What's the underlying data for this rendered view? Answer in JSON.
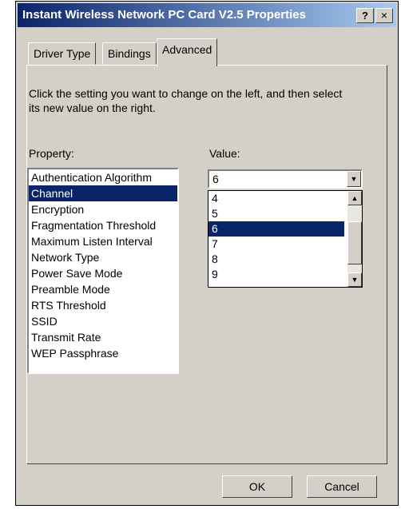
{
  "window": {
    "title": "Instant Wireless Network PC Card V2.5 Properties"
  },
  "titlebar": {
    "help_label": "?",
    "close_label": "×"
  },
  "tabs": [
    {
      "label": "Driver Type"
    },
    {
      "label": "Bindings"
    },
    {
      "label": "Advanced"
    }
  ],
  "instructions": "Click the setting you want to change on the left, and then select its new value on the right.",
  "property": {
    "label": "Property:",
    "items": [
      "Authentication Algorithm",
      "Channel",
      "Encryption",
      "Fragmentation Threshold",
      "Maximum Listen Interval",
      "Network Type",
      "Power Save Mode",
      "Preamble Mode",
      "RTS Threshold",
      "SSID",
      "Transmit Rate",
      "WEP Passphrase"
    ],
    "selected": "Channel"
  },
  "value": {
    "label": "Value:",
    "current": "6",
    "options": [
      "4",
      "5",
      "6",
      "7",
      "8",
      "9"
    ],
    "selected": "6"
  },
  "buttons": {
    "ok": "OK",
    "cancel": "Cancel"
  },
  "colors": {
    "face": "#d4d0c8",
    "selection": "#0a246a",
    "title_start": "#0a246a",
    "title_end": "#a6caf0"
  },
  "icons": {
    "dropdown_arrow": "chevron-down-icon",
    "scroll_up": "chevron-up-icon",
    "scroll_down": "chevron-down-icon"
  }
}
